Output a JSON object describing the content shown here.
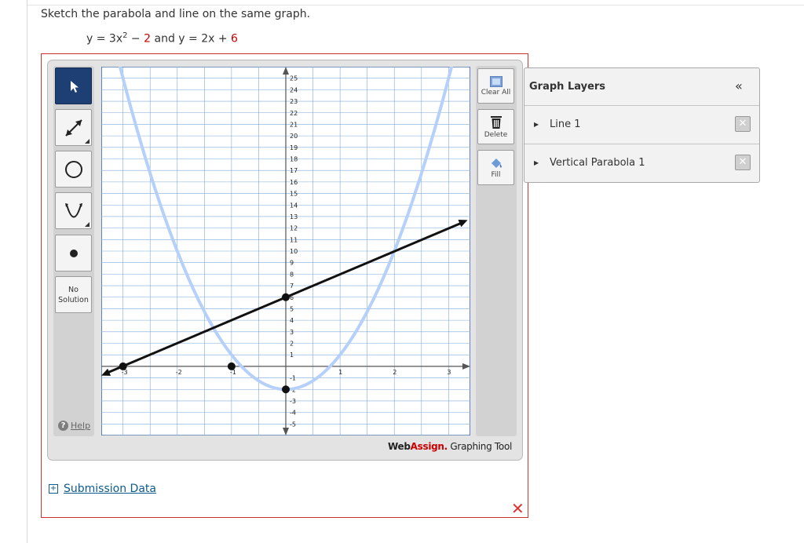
{
  "question": {
    "prompt": "Sketch the parabola and line on the same graph.",
    "eq1_lhs": "y = 3x",
    "eq1_exp": "2",
    "eq1_minus": " − ",
    "eq1_const": "2",
    "conj": " and ",
    "eq2_lhs": "y = 2x + ",
    "eq2_const": "6"
  },
  "toolbar": {
    "no_solution_line1": "No",
    "no_solution_line2": "Solution",
    "help": "Help"
  },
  "actions": {
    "clear_all": "Clear All",
    "delete": "Delete",
    "fill": "Fill"
  },
  "brand": {
    "web": "Web",
    "assign": "Assign.",
    "tool": " Graphing Tool"
  },
  "submission": {
    "label": "Submission Data"
  },
  "layers": {
    "title": "Graph Layers",
    "collapse_glyph": "«",
    "items": [
      {
        "label": "Line 1"
      },
      {
        "label": "Vertical Parabola 1"
      }
    ]
  },
  "colors": {
    "accent_red": "#cc0000",
    "link_blue": "#0d5b8c",
    "active_tool": "#1e3f73",
    "parabola": "#b5d0fb"
  },
  "chart_data": {
    "type": "line",
    "xlim": [
      -3.4,
      3.4
    ],
    "ylim": [
      -6,
      26
    ],
    "x_ticks": [
      -3,
      -2,
      -1,
      1,
      2,
      3
    ],
    "y_ticks": [
      -5,
      -4,
      -3,
      -2,
      -1,
      1,
      2,
      3,
      4,
      5,
      6,
      7,
      8,
      9,
      10,
      11,
      12,
      13,
      14,
      15,
      16,
      17,
      18,
      19,
      20,
      21,
      22,
      23,
      24,
      25
    ],
    "grid": true,
    "line": {
      "slope": 2,
      "intercept": 6,
      "points": [
        [
          -3,
          0
        ],
        [
          0,
          6
        ]
      ]
    },
    "parabola": {
      "a": 3,
      "c": -2,
      "vertex": [
        0,
        -2
      ]
    },
    "marked_points": [
      [
        -1,
        0
      ],
      [
        0,
        -2
      ]
    ]
  }
}
